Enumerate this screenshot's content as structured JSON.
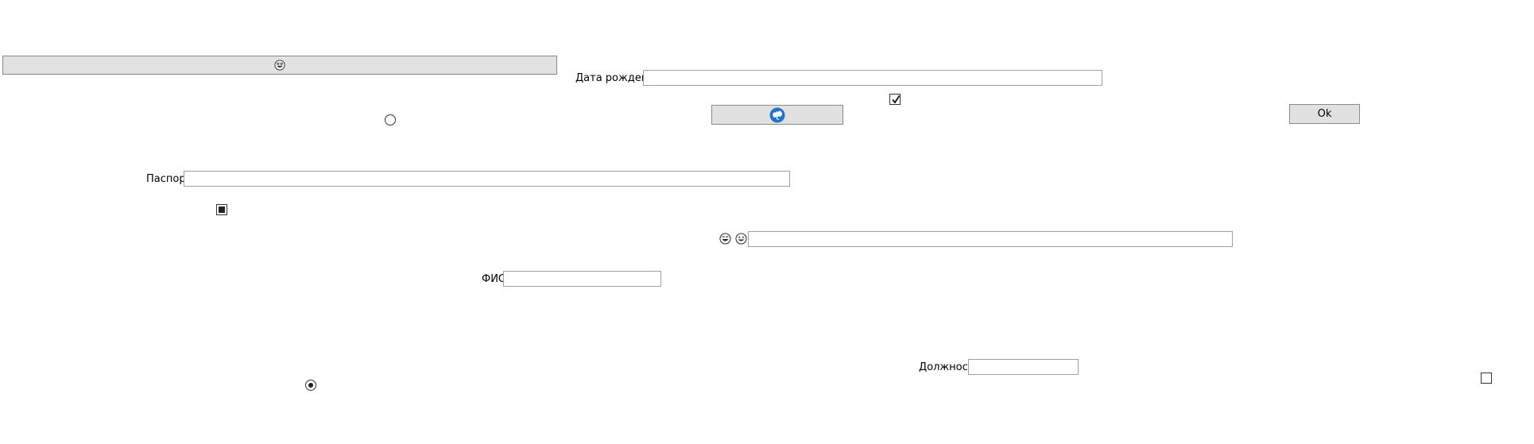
{
  "window": {
    "background": "#ffffff"
  },
  "top_button": {
    "icon": "grinning-face-icon",
    "label": ""
  },
  "birth_date": {
    "label": "Дата рождения",
    "value": "",
    "placeholder": ""
  },
  "top_checkbox": {
    "checked": true
  },
  "globe_button": {
    "icon": "globe-icon",
    "label": ""
  },
  "ok_button": {
    "label": "Ok"
  },
  "radio_top": {
    "selected": false
  },
  "passport": {
    "label": "Паспорт",
    "value": "",
    "placeholder": ""
  },
  "indeterminate_checkbox": {
    "state": "indeterminate"
  },
  "emoji_field": {
    "icons": [
      "laughing-face-icon",
      "smiling-face-icon"
    ],
    "value": "",
    "placeholder": ""
  },
  "fio": {
    "label": "ФИО",
    "value": "",
    "placeholder": ""
  },
  "position": {
    "label": "Должность",
    "value": "",
    "placeholder": ""
  },
  "radio_bottom": {
    "selected": true
  },
  "bottom_checkbox": {
    "checked": false
  }
}
